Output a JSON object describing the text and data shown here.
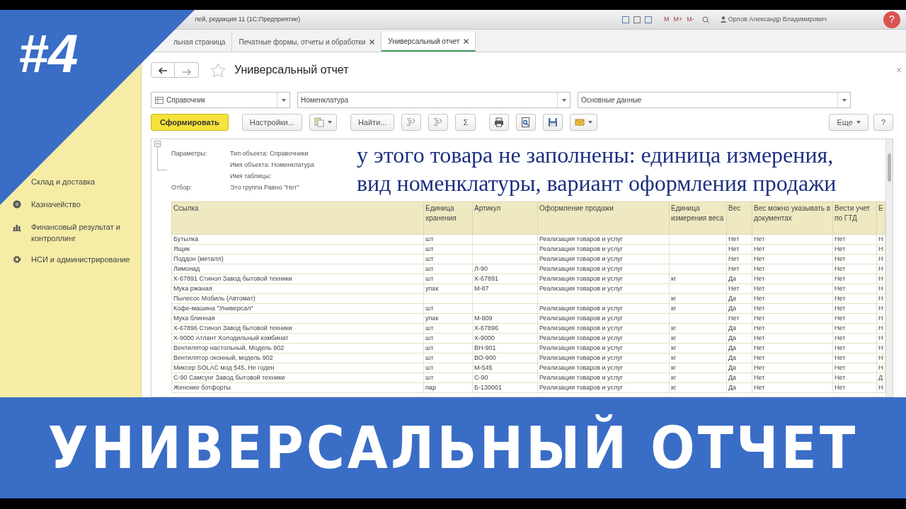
{
  "title_bar": {
    "title": "лей, редакция 11 (1С:Предприятие)",
    "calc_buttons": [
      "M",
      "M+",
      "M-"
    ],
    "user": "Орлов Александр Владимирович",
    "help": "?"
  },
  "tabs": [
    {
      "label": "льная страница",
      "selected": false,
      "closable": false
    },
    {
      "label": "Печатные формы, отчеты и обработки",
      "selected": false,
      "closable": true
    },
    {
      "label": "Универсальный отчет",
      "selected": true,
      "closable": true
    }
  ],
  "sidebar": {
    "items": [
      {
        "label": "Склад и доставка"
      },
      {
        "label": "Казначейство"
      },
      {
        "label": "Финансовый результат и контроллинг"
      },
      {
        "label": "НСИ и администрирование"
      }
    ]
  },
  "report": {
    "title": "Универсальный отчет",
    "selectors": [
      {
        "value": "Справочник"
      },
      {
        "value": "Номенклатура"
      },
      {
        "value": "Основные данные"
      }
    ],
    "toolbar": [
      [
        {
          "kind": "primary",
          "label": "Сформировать"
        }
      ],
      [
        {
          "kind": "text",
          "label": "Настройки..."
        },
        {
          "kind": "icon",
          "dropdown": true
        }
      ],
      [
        {
          "kind": "text",
          "label": "Найти..."
        },
        {
          "kind": "icon",
          "dropdown": false
        },
        {
          "kind": "icon",
          "dropdown": false
        },
        {
          "kind": "text",
          "label": "Σ"
        }
      ],
      [
        {
          "kind": "icon",
          "dropdown": false
        },
        {
          "kind": "icon",
          "dropdown": false
        },
        {
          "kind": "icon",
          "dropdown": false
        },
        {
          "kind": "icon",
          "dropdown": true
        }
      ]
    ],
    "toolbar_right": [
      {
        "kind": "text",
        "label": "Еще",
        "dropdown": true
      },
      {
        "kind": "text",
        "label": "?"
      }
    ],
    "parameters": [
      {
        "label": "Параметры:",
        "values": [
          "Тип объекта: Справочники",
          "Имя объекта: Номенклатура",
          "Имя таблицы:"
        ]
      },
      {
        "label": "Отбор:",
        "values": [
          "Это группа Равно \"Нет\""
        ]
      }
    ],
    "note": [
      "у этого товара не заполнены: единица измерения,",
      "вид номенклатуры, вариант оформления продажи"
    ],
    "table": {
      "columns": [
        "Ссылка",
        "Единица хранения",
        "Артикул",
        "Оформление продажи",
        "Единица измерения веса",
        "Вес",
        "Вес можно указывать в документах",
        "Вести учет по ГТД",
        "Е"
      ],
      "rows": [
        [
          "Бутылка",
          "шт",
          "",
          "Реализация товаров и услуг",
          "",
          "Нет",
          "Нет",
          "Нет",
          "Н"
        ],
        [
          "Ящик",
          "шт",
          "",
          "Реализация товаров и услуг",
          "",
          "Нет",
          "Нет",
          "Нет",
          "Н"
        ],
        [
          "Поддон (металл)",
          "шт",
          "",
          "Реализация товаров и услуг",
          "",
          "Нет",
          "Нет",
          "Нет",
          "Н"
        ],
        [
          "Лимонад",
          "шт",
          "Л-90",
          "Реализация товаров и услуг",
          "",
          "Нет",
          "Нет",
          "Нет",
          "Н"
        ],
        [
          "Х-67891 Стинол Завод бытовой техники",
          "шт",
          "Х-67891",
          "Реализация товаров и услуг",
          "кг",
          "Да",
          "Нет",
          "Нет",
          "Н"
        ],
        [
          "Мука ржаная",
          "упак",
          "М-87",
          "Реализация товаров и услуг",
          "",
          "Нет",
          "Нет",
          "Нет",
          "Н"
        ],
        [
          "Пылесос Мобиль (Автомат)",
          "",
          "",
          "",
          "кг",
          "Да",
          "Нет",
          "Нет",
          "Н"
        ],
        [
          "Кофе-машина \"Универсал\"",
          "шт",
          "",
          "Реализация товаров и услуг",
          "кг",
          "Да",
          "Нет",
          "Нет",
          "Н"
        ],
        [
          "Мука блинная",
          "упак",
          "М-809",
          "Реализация товаров и услуг",
          "",
          "Нет",
          "Нет",
          "Нет",
          "Н"
        ],
        [
          "Х-67896 Стинол Завод бытовой техники",
          "шт",
          "Х-67896",
          "Реализация товаров и услуг",
          "кг",
          "Да",
          "Нет",
          "Нет",
          "Н"
        ],
        [
          "Х-9000 Атлант Холодильный комбинат",
          "шт",
          "Х-9000",
          "Реализация товаров и услуг",
          "кг",
          "Да",
          "Нет",
          "Нет",
          "Н"
        ],
        [
          "Вентилятор настольный, Модель 902",
          "шт",
          "ВН-901",
          "Реализация товаров и услуг",
          "кг",
          "Да",
          "Нет",
          "Нет",
          "Н"
        ],
        [
          "Вентилятор оконный, модель 902",
          "шт",
          "ВО-900",
          "Реализация товаров и услуг",
          "кг",
          "Да",
          "Нет",
          "Нет",
          "Н"
        ],
        [
          "Миксер SOLAC мод 545, Не годен",
          "шт",
          "М-545",
          "Реализация товаров и услуг",
          "кг",
          "Да",
          "Нет",
          "Нет",
          "Н"
        ],
        [
          "С-90 Самсунг Завод бытовой техники",
          "шт",
          "С-90",
          "Реализация товаров и услуг",
          "кг",
          "Да",
          "Нет",
          "Нет",
          "Д"
        ],
        [
          "Женские ботфорты",
          "пар",
          "Б-130001",
          "Реализация товаров и услуг",
          "кг",
          "Да",
          "Нет",
          "Нет",
          "Н"
        ]
      ]
    }
  },
  "overlay": {
    "episode": "#4",
    "banner": "УНИВЕРСАЛЬНЫЙ ОТЧЕТ"
  }
}
